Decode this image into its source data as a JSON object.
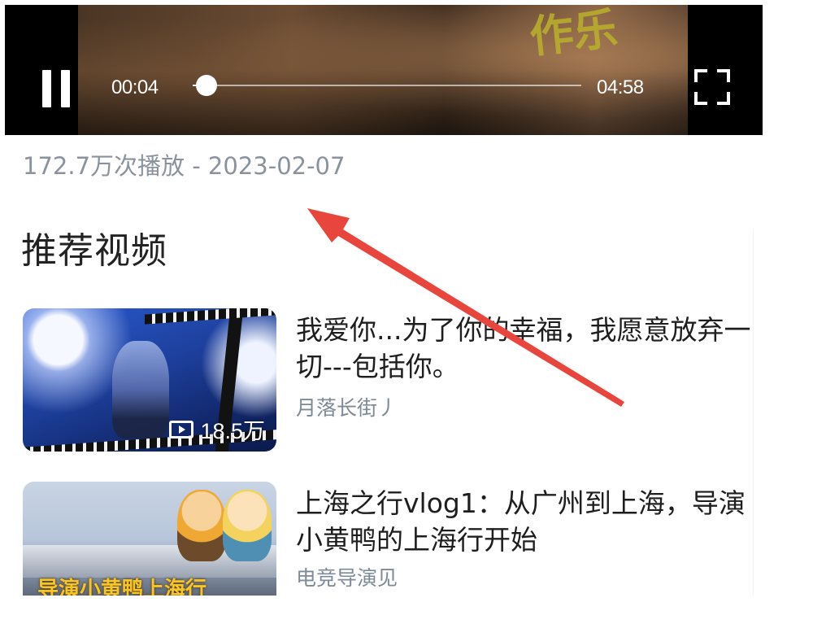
{
  "player": {
    "current_time": "00:04",
    "total_time": "04:58",
    "progress_fraction": 0.013,
    "video_overlay_text": "作乐"
  },
  "video_meta": "172.7万次播放 - 2023-02-07",
  "recommended": {
    "heading": "推荐视频",
    "items": [
      {
        "title": "我爱你...为了你的幸福，我愿意放弃一切---包括你。",
        "author": "月落长街丿",
        "play_count": "18.5万"
      },
      {
        "title": "上海之行vlog1：从广州到上海，导演小黄鸭的上海行开始",
        "author": "电竞导演见",
        "thumb_text": "导演小黄鸭上海行"
      }
    ]
  },
  "colors": {
    "annotation_arrow": "#e8453c",
    "meta_text": "#8a939d",
    "author_text": "#7d8a97"
  }
}
